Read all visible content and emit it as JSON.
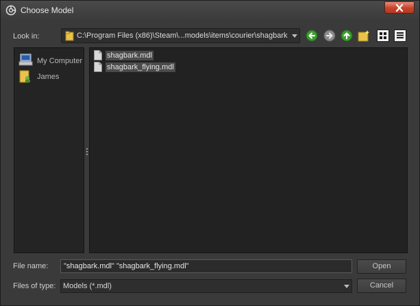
{
  "window": {
    "title": "Choose Model"
  },
  "lookin": {
    "label": "Look in:",
    "path": "C:\\Program Files (x86)\\Steam\\...models\\items\\courier\\shagbark"
  },
  "toolbar": {
    "icons": [
      "back-arrow-icon",
      "forward-arrow-icon",
      "up-arrow-icon",
      "new-folder-icon",
      "list-view-icon",
      "detail-view-icon"
    ]
  },
  "sidebar": {
    "items": [
      {
        "label": "My Computer",
        "icon": "computer-icon"
      },
      {
        "label": "James",
        "icon": "user-folder-icon"
      }
    ]
  },
  "files": [
    {
      "name": "shagbark.mdl"
    },
    {
      "name": "shagbark_flying.mdl"
    }
  ],
  "filename": {
    "label": "File name:",
    "value": "\"shagbark.mdl\" \"shagbark_flying.mdl\""
  },
  "filetype": {
    "label": "Files of type:",
    "value": "Models (*.mdl)"
  },
  "buttons": {
    "open": "Open",
    "cancel": "Cancel"
  },
  "colors": {
    "close_button": "#c6432c",
    "nav_green": "#3c9a2e",
    "folder_yellow": "#e8c24a"
  }
}
